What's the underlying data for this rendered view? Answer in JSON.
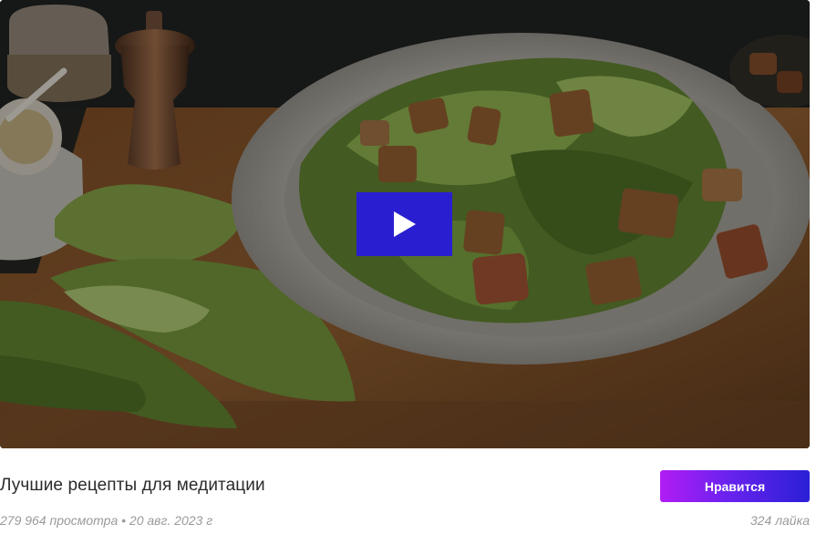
{
  "video": {
    "thumbnail": "salad-plate-on-cutting-board",
    "play_icon": "play-icon"
  },
  "card": {
    "title": "Лучшие рецепты для медитации",
    "like_button_label": "Нравится",
    "meta": "279 964 просмотра • 20 авг. 2023 г",
    "likes": "324 лайка"
  },
  "colors": {
    "play_button": "#2a1fd0",
    "like_gradient_start": "#b21cf4",
    "like_gradient_end": "#2a20d6",
    "meta_text": "#9a9a9a"
  }
}
